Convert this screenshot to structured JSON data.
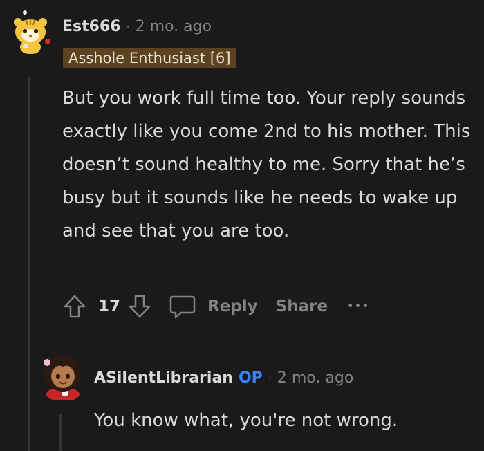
{
  "comment": {
    "username": "Est666",
    "separator": "·",
    "time": "2 mo. ago",
    "flair": "Asshole Enthusiast [6]",
    "body": "But you work full time too. Your reply sounds exactly like you come 2nd to his mother. This doesn’t sound healthy to me. Sorry that he’s busy but it sounds like he needs to wake up and see that you are too.",
    "votes": "17",
    "reply_label": "Reply",
    "share_label": "Share",
    "more_label": "•••"
  },
  "reply": {
    "username": "ASilentLibrarian",
    "op_badge": "OP",
    "separator": "·",
    "time": "2 mo. ago",
    "body": "You know what, you're not wrong."
  },
  "colors": {
    "background": "#1a1a1b",
    "text": "#d7dadc",
    "muted": "#818384",
    "flair_bg": "#5c4320",
    "op": "#3b82f6"
  }
}
